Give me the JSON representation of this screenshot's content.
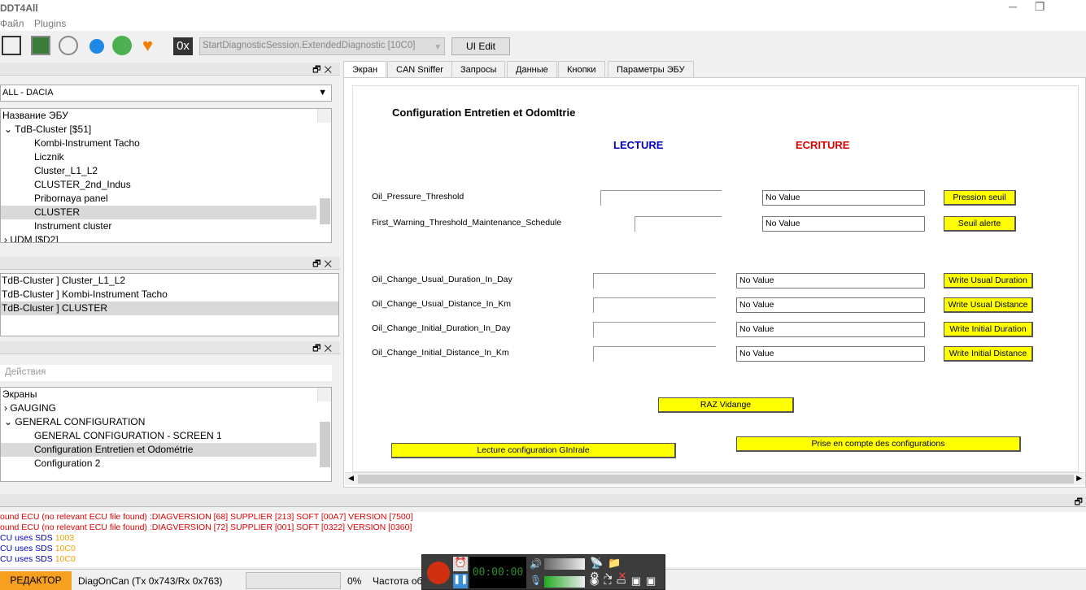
{
  "window": {
    "title": "DDT4All"
  },
  "menu": [
    "Файл",
    "Plugins"
  ],
  "toolbar": {
    "session_combo": "StartDiagnosticSession.ExtendedDiagnostic [10C0]",
    "ui_edit": "UI Edit",
    "hex_label": "0x"
  },
  "ecu_panel": {
    "vehicle_combo": "ALL - DACIA",
    "tree_header": "Название ЭБУ",
    "items": [
      "TdB-Cluster [$51]",
      "Kombi-Instrument Tacho",
      "Licznik",
      "Cluster_L1_L2",
      "CLUSTER_2nd_Indus",
      "Pribornaya panel",
      "CLUSTER",
      "Instrument cluster",
      "UDM [$D2]"
    ]
  },
  "found_panel": {
    "items": [
      "TdB-Cluster ] Cluster_L1_L2",
      "TdB-Cluster ] Kombi-Instrument Tacho",
      "TdB-Cluster ] CLUSTER"
    ]
  },
  "screens_panel": {
    "actions_placeholder": "Действия",
    "tree_header": "Экраны",
    "items": [
      "GAUGING",
      "GENERAL CONFIGURATION",
      "GENERAL CONFIGURATION - SCREEN 1",
      "Configuration Entretien et Odométrie",
      "Configuration 2"
    ]
  },
  "tabs": [
    "Экран",
    "CAN Sniffer",
    "Запросы",
    "Данные",
    "Кнопки",
    "Параметры ЭБУ"
  ],
  "screen": {
    "title": "Configuration Entretien et OdomItrie",
    "read_header": "LECTURE",
    "write_header": "ECRITURE",
    "rows": [
      {
        "label": "Oil_Pressure_Threshold",
        "value": "No Value",
        "button": "Pression seuil"
      },
      {
        "label": "First_Warning_Threshold_Maintenance_Schedule",
        "value": "No Value",
        "button": "Seuil alerte"
      },
      {
        "label": "Oil_Change_Usual_Duration_In_Day",
        "value": "No Value",
        "button": "Write Usual Duration"
      },
      {
        "label": "Oil_Change_Usual_Distance_In_Km",
        "value": "No Value",
        "button": "Write Usual Distance"
      },
      {
        "label": "Oil_Change_Initial_Duration_In_Day",
        "value": "No Value",
        "button": "Write Initial Duration"
      },
      {
        "label": "Oil_Change_Initial_Distance_In_Km",
        "value": "No Value",
        "button": "Write Initial Distance"
      }
    ],
    "raz_button": "RAZ Vidange",
    "read_all_button": "Lecture configuration GInIrale",
    "apply_button": "Prise en compte des configurations"
  },
  "log": [
    {
      "text": "ound ECU (no relevant ECU file found) :DIAGVERSION [68] SUPPLIER [213] SOFT [00A7] VERSION [7500]",
      "color": "#e00000"
    },
    {
      "text": "ound ECU (no relevant ECU file found) :DIAGVERSION [72] SUPPLIER [001] SOFT [0322] VERSION [0360]",
      "color": "#e00000"
    },
    {
      "text": "CU uses SDS ",
      "code": "1003",
      "color": "#0000c0"
    },
    {
      "text": "CU uses SDS ",
      "code": "10C0",
      "color": "#0000c0"
    },
    {
      "text": "CU uses SDS ",
      "code": "10C0",
      "color": "#0000c0"
    }
  ],
  "status": {
    "mode": "РЕДАКТОР",
    "connection": "DiagOnCan (Tx 0x743/Rx 0x763)",
    "progress": "0%",
    "freq": "Частота об"
  },
  "recorder": {
    "timer": "00:00:00"
  }
}
